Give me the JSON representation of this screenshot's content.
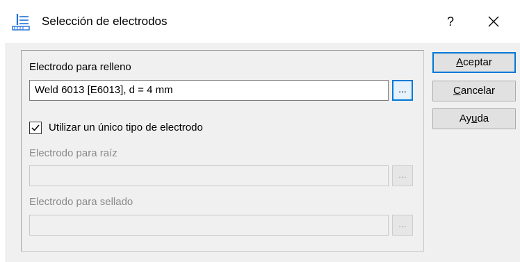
{
  "window": {
    "title": "Selección de electrodos",
    "help_label": "?",
    "icon": "electrode-app-icon",
    "close_icon": "close-icon"
  },
  "fill": {
    "label": "Electrodo para relleno",
    "value": "Weld 6013 [E6013], d = 4 mm",
    "browse_label": "..."
  },
  "single_type": {
    "label": "Utilizar un único tipo de electrodo",
    "checked": true
  },
  "root": {
    "label": "Electrodo para raíz",
    "value": "",
    "browse_label": "..."
  },
  "seal": {
    "label": "Electrodo para sellado",
    "value": "",
    "browse_label": "..."
  },
  "buttons": {
    "accept": {
      "first": "A",
      "rest": "ceptar"
    },
    "cancel": {
      "first": "C",
      "rest": "ancelar"
    },
    "help": {
      "before": "Ay",
      "mnemonic": "u",
      "after": "da"
    }
  },
  "colors": {
    "accent": "#0078d7",
    "disabled_text": "#8a8a8a",
    "client_bg": "#f0f0f0"
  }
}
